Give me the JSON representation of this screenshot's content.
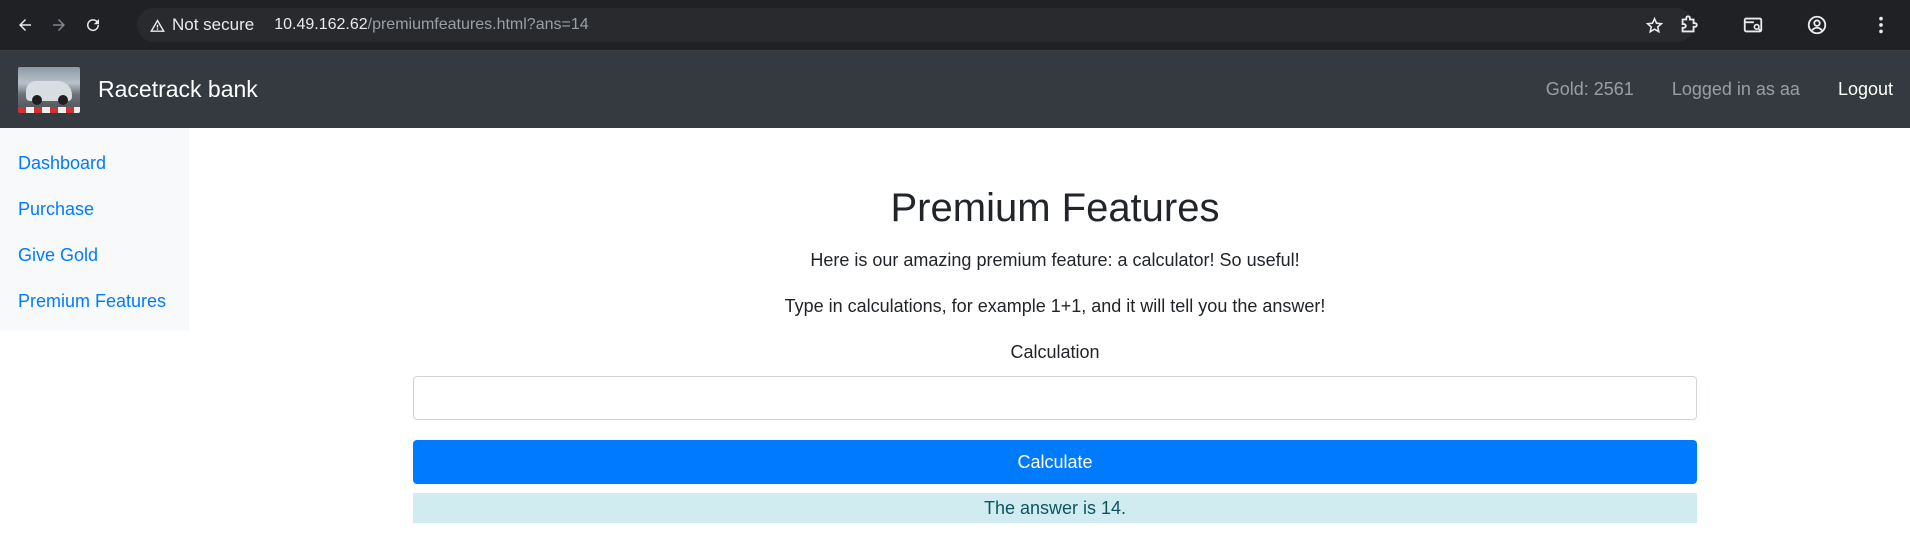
{
  "browser": {
    "security_label": "Not secure",
    "url_host": "10.49.162.62",
    "url_path": "/premiumfeatures.html?ans=14"
  },
  "navbar": {
    "brand": "Racetrack bank",
    "gold": "Gold: 2561",
    "logged_in": "Logged in as aa",
    "logout": "Logout"
  },
  "sidebar": {
    "items": [
      {
        "label": "Dashboard"
      },
      {
        "label": "Purchase"
      },
      {
        "label": "Give Gold"
      },
      {
        "label": "Premium Features"
      }
    ]
  },
  "main": {
    "title": "Premium Features",
    "intro": "Here is our amazing premium feature: a calculator! So useful!",
    "instructions": "Type in calculations, for example 1+1, and it will tell you the answer!",
    "field_label": "Calculation",
    "field_value": "",
    "button_label": "Calculate",
    "answer": "The answer is 14."
  },
  "colors": {
    "navbar_bg": "#343a40",
    "link": "#007bff",
    "primary_button": "#007bff",
    "alert_bg": "#d1ecf1",
    "alert_text": "#0c5460"
  }
}
